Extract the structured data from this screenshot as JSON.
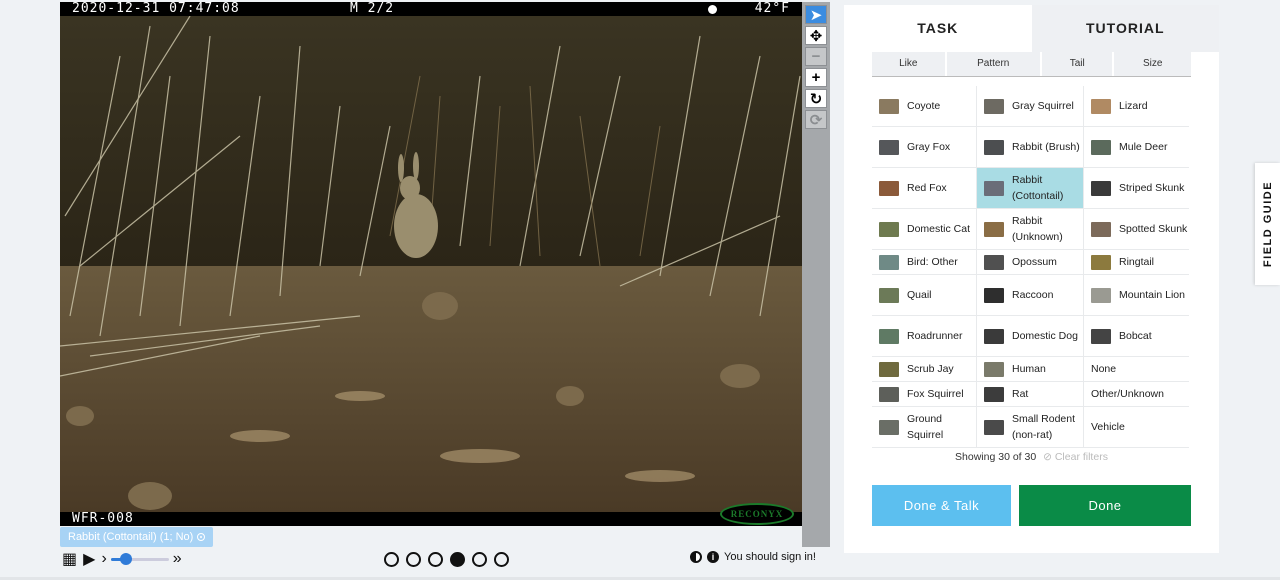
{
  "photo": {
    "datetime": "2020-12-31  07:47:08",
    "burst": "M 2/2",
    "temperature": "42°F",
    "camera_id": "WFR-008",
    "brand": "RECONYX"
  },
  "toolbar": {
    "tools": [
      {
        "name": "pointer",
        "glyph": "➤"
      },
      {
        "name": "move",
        "glyph": "✥"
      },
      {
        "name": "zoom-out",
        "glyph": "−"
      },
      {
        "name": "zoom-in",
        "glyph": "+"
      },
      {
        "name": "rotate",
        "glyph": "↻"
      },
      {
        "name": "reset",
        "glyph": "⟳"
      }
    ]
  },
  "annotation": {
    "label": "Rabbit (Cottontail) (1; No)"
  },
  "playback": {
    "grid": "▦",
    "play": "▶",
    "step": "›",
    "fast": "»",
    "speed_fraction": 0.2
  },
  "frames": {
    "count": 6,
    "active_index": 3
  },
  "footer": {
    "sign_in": "You should sign in!"
  },
  "tabs": {
    "task": "TASK",
    "tutorial": "TUTORIAL"
  },
  "filters": [
    "Like",
    "Pattern",
    "Tail",
    "Size"
  ],
  "choices": [
    {
      "label": "Coyote",
      "thumb": "#8a7a60"
    },
    {
      "label": "Gray Squirrel",
      "thumb": "#6d6a62"
    },
    {
      "label": "Lizard",
      "thumb": "#b08a63"
    },
    {
      "label": "Gray Fox",
      "thumb": "#55575a"
    },
    {
      "label": "Rabbit (Brush)",
      "thumb": "#4c4e50"
    },
    {
      "label": "Mule Deer",
      "thumb": "#5b6a5c"
    },
    {
      "label": "Red Fox",
      "thumb": "#8b5a3a"
    },
    {
      "label": "Rabbit (Cottontail)",
      "thumb": "#6a6d78"
    },
    {
      "label": "Striped Skunk",
      "thumb": "#3a3a3a"
    },
    {
      "label": "Domestic Cat",
      "thumb": "#6e7a4f"
    },
    {
      "label": "Rabbit (Unknown)",
      "thumb": "#8a6d45"
    },
    {
      "label": "Spotted Skunk",
      "thumb": "#7c6a5a"
    },
    {
      "label": "Bird: Other",
      "thumb": "#6f8a86"
    },
    {
      "label": "Opossum",
      "thumb": "#505050"
    },
    {
      "label": "Ringtail",
      "thumb": "#8c7a3e"
    },
    {
      "label": "Quail",
      "thumb": "#6c7a58"
    },
    {
      "label": "Raccoon",
      "thumb": "#2e2e2e"
    },
    {
      "label": "Mountain Lion",
      "thumb": "#9a9a92"
    },
    {
      "label": "Roadrunner",
      "thumb": "#5f7a64"
    },
    {
      "label": "Domestic Dog",
      "thumb": "#3a3a3a"
    },
    {
      "label": "Bobcat",
      "thumb": "#444444"
    },
    {
      "label": "Scrub Jay",
      "thumb": "#6f6a3e"
    },
    {
      "label": "Human",
      "thumb": "#7a7a6a"
    },
    {
      "label": "None",
      "thumb": ""
    },
    {
      "label": "Fox Squirrel",
      "thumb": "#5d5f5a"
    },
    {
      "label": "Rat",
      "thumb": "#3c3c3c"
    },
    {
      "label": "Other/Unknown",
      "thumb": ""
    },
    {
      "label": "Ground Squirrel",
      "thumb": "#6a6e66"
    },
    {
      "label": "Small Rodent (non-rat)",
      "thumb": "#4a4a4a"
    },
    {
      "label": "Vehicle",
      "thumb": ""
    }
  ],
  "selected_choice": "Rabbit (Cottontail)",
  "showing": {
    "text": "Showing 30 of 30",
    "clear": "Clear filters"
  },
  "buttons": {
    "done_talk": "Done & Talk",
    "done": "Done"
  },
  "field_guide": "FIELD GUIDE",
  "colors": {
    "accent_blue": "#5cbfef",
    "done_green": "#0a8b47",
    "selected": "#a9dce4"
  }
}
